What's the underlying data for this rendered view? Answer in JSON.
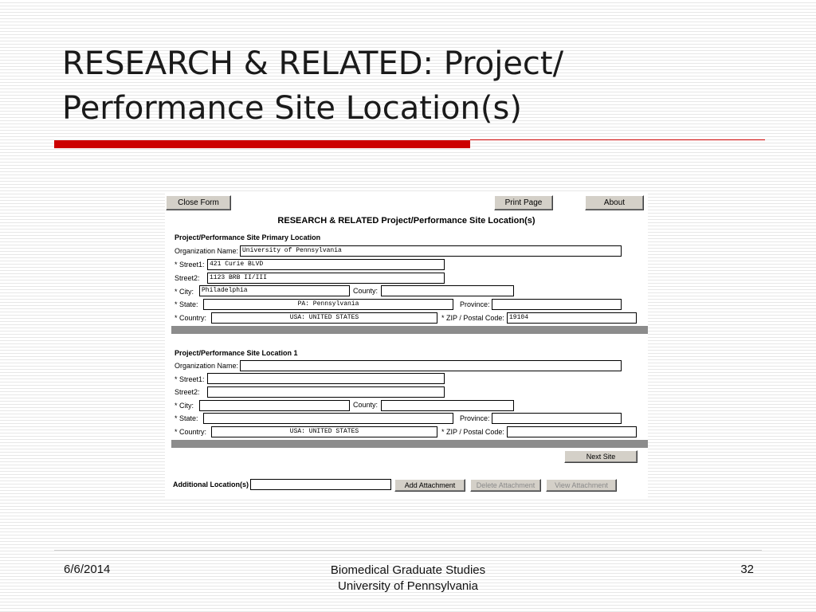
{
  "slide": {
    "title_line1": "RESEARCH & RELATED: Project/",
    "title_line2": "Performance Site Location(s)",
    "footer_date": "6/6/2014",
    "footer_org_line1": "Biomedical Graduate Studies",
    "footer_org_line2": "University of Pennsylvania",
    "page_number": "32",
    "accent_color": "#cc0000"
  },
  "form": {
    "close_label": "Close Form",
    "print_label": "Print Page",
    "about_label": "About",
    "heading": "RESEARCH & RELATED Project/Performance Site Location(s)",
    "labels": {
      "org": "Organization Name:",
      "street1": "* Street1:",
      "street2": "Street2:",
      "city": "* City:",
      "county": "County:",
      "state": "* State:",
      "province": "Province:",
      "country": "* Country:",
      "zip": "* ZIP / Postal Code:"
    },
    "primary": {
      "title": "Project/Performance Site Primary Location",
      "org": "University of Pennsylvania",
      "street1": "421 Curie BLVD",
      "street2": "1123 BRB II/III",
      "city": "Philadelphia",
      "county": "",
      "state": "PA: Pennsylvania",
      "province": "",
      "country": "USA: UNITED STATES",
      "zip": "19104"
    },
    "location1": {
      "title": "Project/Performance Site Location 1",
      "org": "",
      "street1": "",
      "street2": "",
      "city": "",
      "county": "",
      "state": "",
      "province": "",
      "country": "USA: UNITED STATES",
      "zip": ""
    },
    "next_site_label": "Next Site",
    "additional_label": "Additional Location(s)",
    "additional_value": "",
    "add_attachment_label": "Add Attachment",
    "delete_attachment_label": "Delete Attachment",
    "view_attachment_label": "View Attachment"
  }
}
